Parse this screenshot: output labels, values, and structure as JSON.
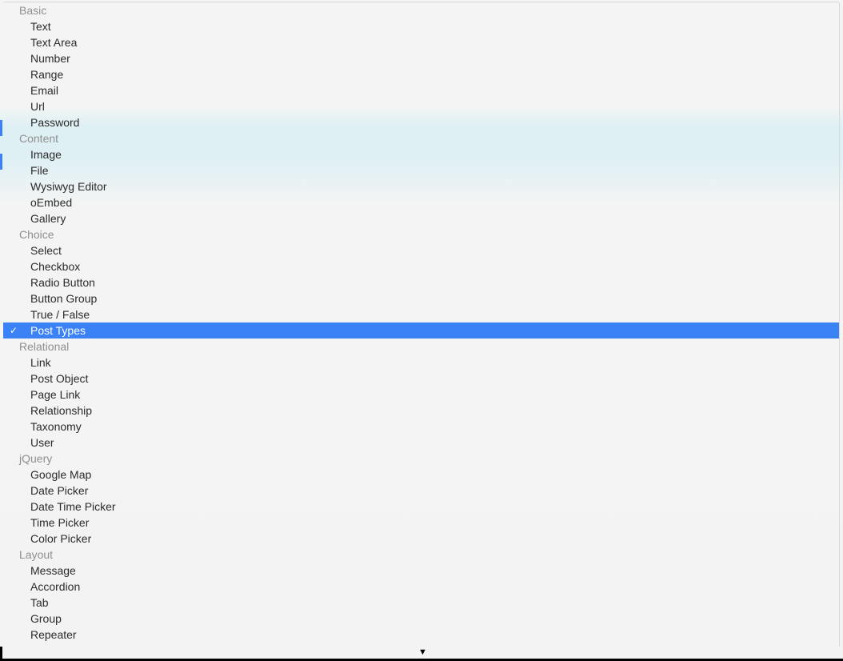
{
  "selected_value": "Post Types",
  "groups": [
    {
      "label": "Basic",
      "items": [
        "Text",
        "Text Area",
        "Number",
        "Range",
        "Email",
        "Url",
        "Password"
      ]
    },
    {
      "label": "Content",
      "items": [
        "Image",
        "File",
        "Wysiwyg Editor",
        "oEmbed",
        "Gallery"
      ]
    },
    {
      "label": "Choice",
      "items": [
        "Select",
        "Checkbox",
        "Radio Button",
        "Button Group",
        "True / False",
        "Post Types"
      ]
    },
    {
      "label": "Relational",
      "items": [
        "Link",
        "Post Object",
        "Page Link",
        "Relationship",
        "Taxonomy",
        "User"
      ]
    },
    {
      "label": "jQuery",
      "items": [
        "Google Map",
        "Date Picker",
        "Date Time Picker",
        "Time Picker",
        "Color Picker"
      ]
    },
    {
      "label": "Layout",
      "items": [
        "Message",
        "Accordion",
        "Tab",
        "Group",
        "Repeater"
      ]
    }
  ],
  "scroll_indicator": "▼"
}
